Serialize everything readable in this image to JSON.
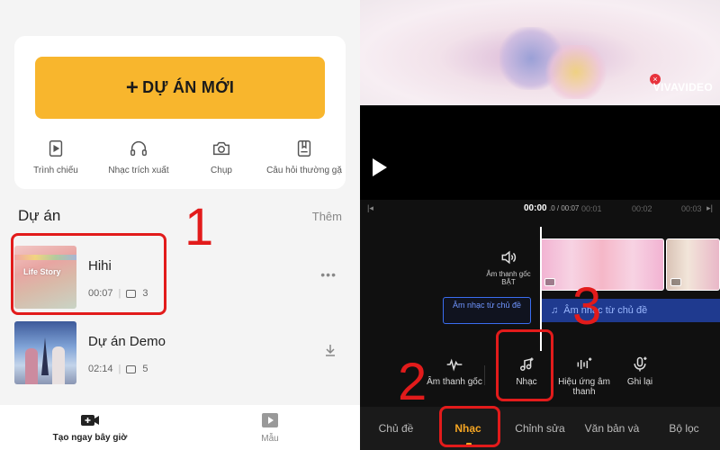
{
  "left": {
    "new_project_label": "DỰ ÁN MỚI",
    "tools": [
      {
        "icon": "slideshow-icon",
        "label": "Trình chiếu"
      },
      {
        "icon": "headphones-icon",
        "label": "Nhạc trích xuất"
      },
      {
        "icon": "camera-icon",
        "label": "Chụp"
      },
      {
        "icon": "faq-icon",
        "label": "Câu hỏi thường gặ"
      }
    ],
    "section_title": "Dự án",
    "section_more": "Thêm",
    "projects": [
      {
        "name": "Hihi",
        "duration": "00:07",
        "clips": "3",
        "thumb_text": "Life Story",
        "action": "more-icon"
      },
      {
        "name": "Dự án Demo",
        "duration": "02:14",
        "clips": "5",
        "action": "download-icon"
      }
    ],
    "bottom_nav": [
      {
        "icon": "camera-plus-icon",
        "label": "Tạo ngay bây giờ",
        "active": true
      },
      {
        "icon": "template-icon",
        "label": "Mẫu",
        "active": false
      }
    ]
  },
  "right": {
    "watermark": "VIVAVIDEO",
    "time": {
      "current": "00:00",
      "total": ".0 / 00:07",
      "m1": "00:01",
      "m2": "00:02",
      "m3": "00:03"
    },
    "original_audio": "Âm thanh gốc BẬT",
    "theme_music_button": "Âm nhạc từ chủ đề",
    "music_track": "Âm nhạc từ chủ đề",
    "actions": [
      {
        "icon": "waveform-icon",
        "label": "Âm thanh gốc"
      },
      {
        "icon": "music-add-icon",
        "label": "Nhạc"
      },
      {
        "icon": "sound-effect-icon",
        "label": "Hiệu ứng âm thanh"
      },
      {
        "icon": "mic-icon",
        "label": "Ghi lại"
      }
    ],
    "tabs": [
      "Chủ đề",
      "Nhạc",
      "Chỉnh sửa",
      "Văn bản và",
      "Bộ lọc"
    ],
    "active_tab": "Nhạc"
  },
  "annotations": [
    "1",
    "2",
    "3"
  ],
  "colors": {
    "accent_orange": "#f8b62d",
    "highlight_red": "#e21b1b",
    "tab_active": "#f6a623",
    "music_blue": "#1f3a8f"
  }
}
